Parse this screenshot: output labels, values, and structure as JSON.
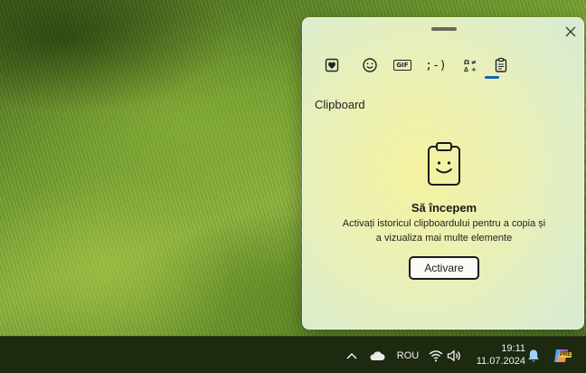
{
  "panel": {
    "tabs": [
      {
        "name": "emoji-favorites",
        "icon": "heart-clipboard-icon"
      },
      {
        "name": "emoji",
        "icon": "smiley-icon"
      },
      {
        "name": "gif",
        "label": "GIF",
        "icon": "gif-icon"
      },
      {
        "name": "kaomoji",
        "label": ";-)",
        "icon": "kaomoji-icon"
      },
      {
        "name": "symbols",
        "icon": "symbols-icon"
      },
      {
        "name": "clipboard",
        "icon": "clipboard-icon",
        "selected": true
      }
    ],
    "section_title": "Clipboard",
    "hero": {
      "title": "Să începem",
      "description": "Activați istoricul clipboardului pentru a copia și a vizualiza mai multe elemente",
      "button_label": "Activare"
    },
    "accent_color": "#1a5fb4"
  },
  "taskbar": {
    "language": "ROU",
    "time": "19:11",
    "date": "11.07.2024",
    "copilot_badge": "PRE"
  }
}
